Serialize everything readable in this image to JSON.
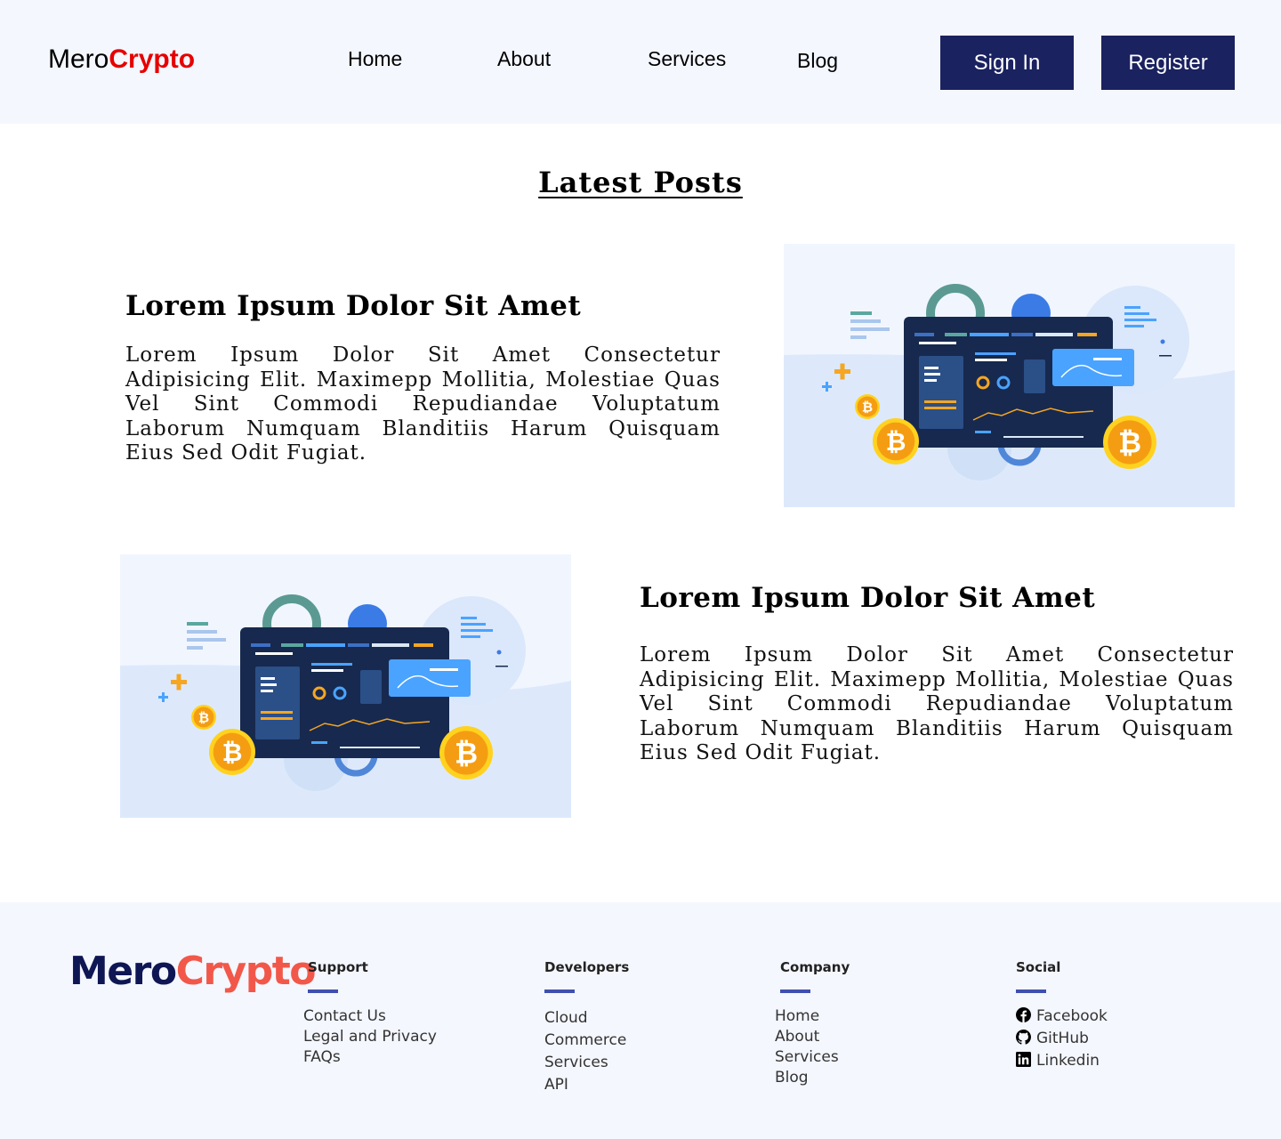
{
  "header": {
    "logo_part1": "Mero",
    "logo_part2": "Crypto",
    "nav": [
      "Home",
      "About",
      "Services",
      "Blog"
    ],
    "signin_label": "Sign In",
    "register_label": "Register"
  },
  "main": {
    "section_title": "Latest Posts",
    "posts": [
      {
        "title": "Lorem Ipsum Dolor Sit Amet",
        "body": "Lorem Ipsum Dolor Sit Amet Consectetur Adipisicing Elit. Maximepp Mollitia, Molestiae Quas Vel Sint Commodi Repudiandae Voluptatum Laborum Numquam Blanditiis Harum Quisquam Eius Sed Odit Fugiat."
      },
      {
        "title": "Lorem Ipsum Dolor Sit Amet",
        "body": "Lorem Ipsum Dolor Sit Amet Consectetur Adipisicing Elit. Maximepp Mollitia, Molestiae Quas Vel Sint Commodi Repudiandae Voluptatum Laborum Numquam Blanditiis Harum Quisquam Eius Sed Odit Fugiat."
      }
    ],
    "illustration_icon": "crypto-dashboard-illustration",
    "coin_glyph": "₿"
  },
  "footer": {
    "logo_part1": "Mero",
    "logo_part2": "Crypto",
    "columns": [
      {
        "heading": "Support",
        "links": [
          "Contact Us",
          "Legal and Privacy",
          "FAQs"
        ]
      },
      {
        "heading": "Developers",
        "links": [
          "Cloud",
          "Commerce",
          "Services",
          "API"
        ]
      },
      {
        "heading": "Company",
        "links": [
          "Home",
          "About",
          "Services",
          "Blog"
        ]
      },
      {
        "heading": "Social",
        "links": [
          "Facebook",
          "GitHub",
          "Linkedin"
        ]
      }
    ],
    "social_icons": [
      "facebook-icon",
      "github-icon",
      "linkedin-icon"
    ]
  },
  "colors": {
    "header_bg": "#f4f7fe",
    "button_bg": "#1a2260",
    "logo_accent": "#e60000",
    "footer_logo_dark": "#0f1654",
    "footer_logo_accent": "#f2584a",
    "footer_bar": "#3f4fb0"
  }
}
